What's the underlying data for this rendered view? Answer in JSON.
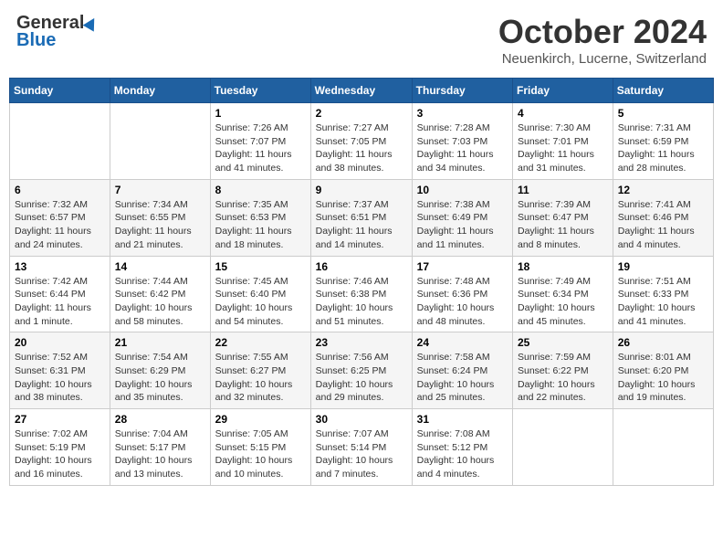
{
  "header": {
    "logo_general": "General",
    "logo_blue": "Blue",
    "month_title": "October 2024",
    "location": "Neuenkirch, Lucerne, Switzerland"
  },
  "weekdays": [
    "Sunday",
    "Monday",
    "Tuesday",
    "Wednesday",
    "Thursday",
    "Friday",
    "Saturday"
  ],
  "weeks": [
    [
      {
        "day": "",
        "info": ""
      },
      {
        "day": "",
        "info": ""
      },
      {
        "day": "1",
        "info": "Sunrise: 7:26 AM\nSunset: 7:07 PM\nDaylight: 11 hours and 41 minutes."
      },
      {
        "day": "2",
        "info": "Sunrise: 7:27 AM\nSunset: 7:05 PM\nDaylight: 11 hours and 38 minutes."
      },
      {
        "day": "3",
        "info": "Sunrise: 7:28 AM\nSunset: 7:03 PM\nDaylight: 11 hours and 34 minutes."
      },
      {
        "day": "4",
        "info": "Sunrise: 7:30 AM\nSunset: 7:01 PM\nDaylight: 11 hours and 31 minutes."
      },
      {
        "day": "5",
        "info": "Sunrise: 7:31 AM\nSunset: 6:59 PM\nDaylight: 11 hours and 28 minutes."
      }
    ],
    [
      {
        "day": "6",
        "info": "Sunrise: 7:32 AM\nSunset: 6:57 PM\nDaylight: 11 hours and 24 minutes."
      },
      {
        "day": "7",
        "info": "Sunrise: 7:34 AM\nSunset: 6:55 PM\nDaylight: 11 hours and 21 minutes."
      },
      {
        "day": "8",
        "info": "Sunrise: 7:35 AM\nSunset: 6:53 PM\nDaylight: 11 hours and 18 minutes."
      },
      {
        "day": "9",
        "info": "Sunrise: 7:37 AM\nSunset: 6:51 PM\nDaylight: 11 hours and 14 minutes."
      },
      {
        "day": "10",
        "info": "Sunrise: 7:38 AM\nSunset: 6:49 PM\nDaylight: 11 hours and 11 minutes."
      },
      {
        "day": "11",
        "info": "Sunrise: 7:39 AM\nSunset: 6:47 PM\nDaylight: 11 hours and 8 minutes."
      },
      {
        "day": "12",
        "info": "Sunrise: 7:41 AM\nSunset: 6:46 PM\nDaylight: 11 hours and 4 minutes."
      }
    ],
    [
      {
        "day": "13",
        "info": "Sunrise: 7:42 AM\nSunset: 6:44 PM\nDaylight: 11 hours and 1 minute."
      },
      {
        "day": "14",
        "info": "Sunrise: 7:44 AM\nSunset: 6:42 PM\nDaylight: 10 hours and 58 minutes."
      },
      {
        "day": "15",
        "info": "Sunrise: 7:45 AM\nSunset: 6:40 PM\nDaylight: 10 hours and 54 minutes."
      },
      {
        "day": "16",
        "info": "Sunrise: 7:46 AM\nSunset: 6:38 PM\nDaylight: 10 hours and 51 minutes."
      },
      {
        "day": "17",
        "info": "Sunrise: 7:48 AM\nSunset: 6:36 PM\nDaylight: 10 hours and 48 minutes."
      },
      {
        "day": "18",
        "info": "Sunrise: 7:49 AM\nSunset: 6:34 PM\nDaylight: 10 hours and 45 minutes."
      },
      {
        "day": "19",
        "info": "Sunrise: 7:51 AM\nSunset: 6:33 PM\nDaylight: 10 hours and 41 minutes."
      }
    ],
    [
      {
        "day": "20",
        "info": "Sunrise: 7:52 AM\nSunset: 6:31 PM\nDaylight: 10 hours and 38 minutes."
      },
      {
        "day": "21",
        "info": "Sunrise: 7:54 AM\nSunset: 6:29 PM\nDaylight: 10 hours and 35 minutes."
      },
      {
        "day": "22",
        "info": "Sunrise: 7:55 AM\nSunset: 6:27 PM\nDaylight: 10 hours and 32 minutes."
      },
      {
        "day": "23",
        "info": "Sunrise: 7:56 AM\nSunset: 6:25 PM\nDaylight: 10 hours and 29 minutes."
      },
      {
        "day": "24",
        "info": "Sunrise: 7:58 AM\nSunset: 6:24 PM\nDaylight: 10 hours and 25 minutes."
      },
      {
        "day": "25",
        "info": "Sunrise: 7:59 AM\nSunset: 6:22 PM\nDaylight: 10 hours and 22 minutes."
      },
      {
        "day": "26",
        "info": "Sunrise: 8:01 AM\nSunset: 6:20 PM\nDaylight: 10 hours and 19 minutes."
      }
    ],
    [
      {
        "day": "27",
        "info": "Sunrise: 7:02 AM\nSunset: 5:19 PM\nDaylight: 10 hours and 16 minutes."
      },
      {
        "day": "28",
        "info": "Sunrise: 7:04 AM\nSunset: 5:17 PM\nDaylight: 10 hours and 13 minutes."
      },
      {
        "day": "29",
        "info": "Sunrise: 7:05 AM\nSunset: 5:15 PM\nDaylight: 10 hours and 10 minutes."
      },
      {
        "day": "30",
        "info": "Sunrise: 7:07 AM\nSunset: 5:14 PM\nDaylight: 10 hours and 7 minutes."
      },
      {
        "day": "31",
        "info": "Sunrise: 7:08 AM\nSunset: 5:12 PM\nDaylight: 10 hours and 4 minutes."
      },
      {
        "day": "",
        "info": ""
      },
      {
        "day": "",
        "info": ""
      }
    ]
  ]
}
